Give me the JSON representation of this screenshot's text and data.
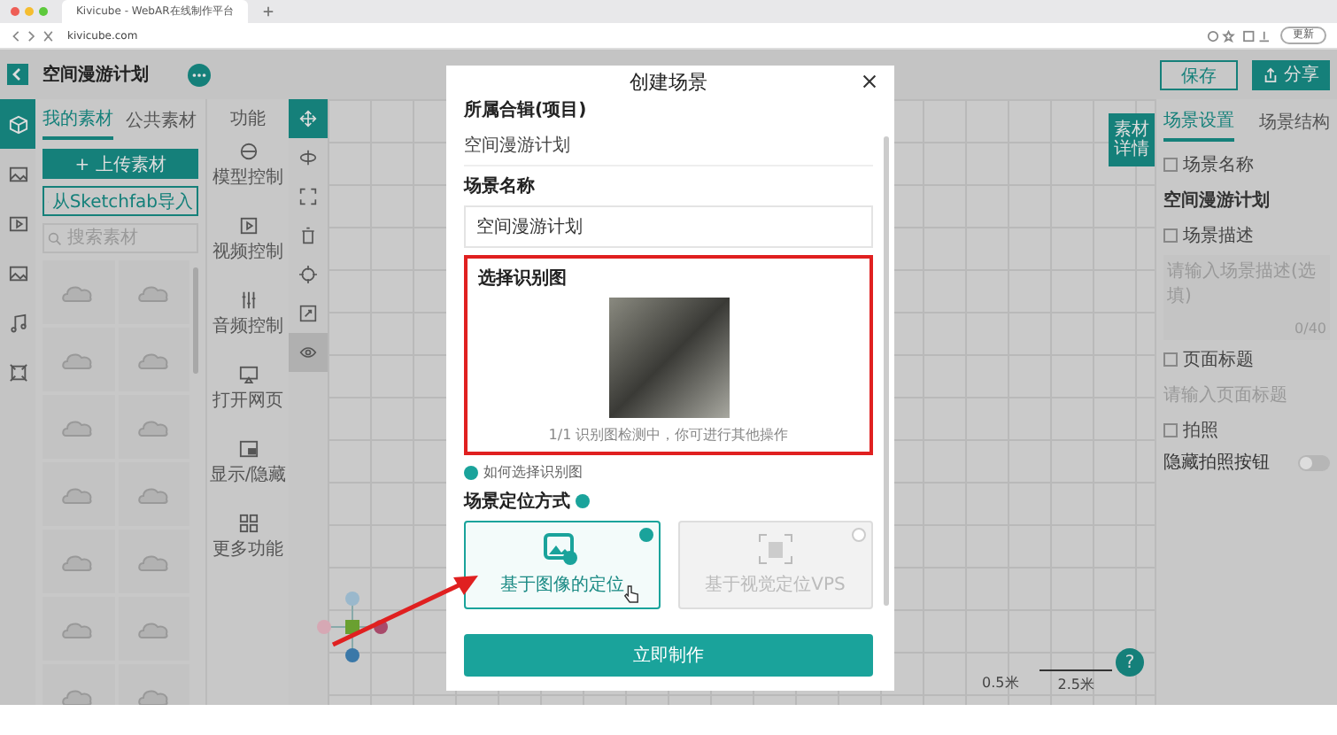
{
  "browser": {
    "tab_title": "Kivicube - WebAR在线制作平台",
    "url": "kivicube.com",
    "update_button": "更新"
  },
  "header": {
    "project_title": "空间漫游计划",
    "save_button": "保存",
    "share_button": "分享"
  },
  "rail": [
    {
      "kind": "cube",
      "selected": true
    },
    {
      "kind": "image",
      "selected": false
    },
    {
      "kind": "video",
      "selected": false
    },
    {
      "kind": "picture",
      "selected": false
    },
    {
      "kind": "music",
      "selected": false
    },
    {
      "kind": "frame",
      "selected": false
    }
  ],
  "materials": {
    "tabs": [
      {
        "label": "我的素材",
        "selected": true
      },
      {
        "label": "公共素材",
        "selected": false
      }
    ],
    "upload_button": "+ 上传素材",
    "import_button": "从Sketchfab导入",
    "search_placeholder": "搜索素材"
  },
  "functions": {
    "title": "功能",
    "items": [
      {
        "kind": "model",
        "label": "模型控制"
      },
      {
        "kind": "video",
        "label": "视频控制"
      },
      {
        "kind": "audio",
        "label": "音频控制"
      },
      {
        "kind": "web",
        "label": "打开网页"
      },
      {
        "kind": "toggle",
        "label": "显示/隐藏"
      },
      {
        "kind": "more",
        "label": "更多功能"
      }
    ]
  },
  "tools": [
    {
      "kind": "move",
      "selected": true,
      "on": false
    },
    {
      "kind": "rotate",
      "selected": false,
      "on": false
    },
    {
      "kind": "scale",
      "selected": false,
      "on": false
    },
    {
      "kind": "delete",
      "selected": false,
      "on": false
    },
    {
      "kind": "focus",
      "selected": false,
      "on": false
    },
    {
      "kind": "fit",
      "selected": false,
      "on": false
    },
    {
      "kind": "view",
      "selected": false,
      "on": true
    }
  ],
  "canvas": {
    "scale_labels": [
      "0.5米",
      "2.5米"
    ],
    "help_button": "?"
  },
  "right_panel": {
    "detail_tab": "素材详情",
    "tabs": [
      {
        "label": "场景设置",
        "selected": true
      },
      {
        "label": "场景结构",
        "selected": false
      }
    ],
    "scene_name_label": "场景名称",
    "scene_name": "空间漫游计划",
    "description_label": "场景描述",
    "description_placeholder": "请输入场景描述(选填)",
    "description_count": "0/40",
    "page_title_label": "页面标题",
    "page_title_placeholder": "请输入页面标题",
    "photo_label": "拍照",
    "hide_photo_label": "隐藏拍照按钮",
    "hide_photo_on": false
  },
  "modal": {
    "title": "创建场景",
    "collection_label": "所属合辑(项目)",
    "collection_value": "空间漫游计划",
    "name_label": "场景名称",
    "name_value": "空间漫游计划",
    "marker_label": "选择识别图",
    "marker_status": "1/1 识别图检测中，你可进行其他操作",
    "help_link": "如何选择识别图",
    "positioning_label": "场景定位方式",
    "options": [
      {
        "kind": "image",
        "label": "基于图像的定位",
        "selected": true,
        "disabled": false
      },
      {
        "kind": "vps",
        "label": "基于视觉定位VPS",
        "selected": false,
        "disabled": true
      }
    ],
    "submit_button": "立即制作"
  }
}
